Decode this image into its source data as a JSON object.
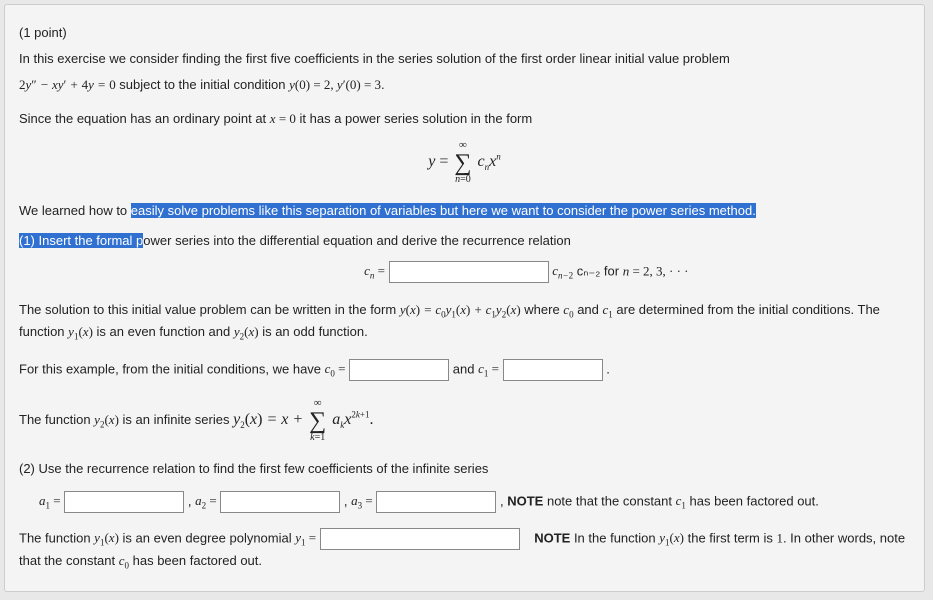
{
  "header": {
    "points": "(1 point)",
    "intro": "In this exercise we consider finding the first five coefficients in the series solution of the first order linear initial value problem",
    "eq_lhs": "2y″ − xy′ + 4y = 0",
    "subject": " subject to the initial condition ",
    "ic": "y(0) = 2, y′(0) = 3",
    "period": "."
  },
  "ordinary": {
    "t1": "Since the equation has an ordinary point at ",
    "eq": "x = 0",
    "t2": " it has a power series solution in the form"
  },
  "series": {
    "y_eq": "y = ",
    "sum_top": "∞",
    "sum_bot": "n=0",
    "term": "cₙxⁿ"
  },
  "q1": {
    "learned": "We learned how to ",
    "hl1": "easily solve problems like this separation of variables but here we want to consider the power series method.",
    "hl2": "(1) Insert the formal p",
    "rest": "ower series into the differential equation and derive the recurrence relation"
  },
  "recur": {
    "lhs": "cₙ =",
    "rhs1": " cₙ₋₂ for ",
    "rhs2": "n = 2, 3, · · ·"
  },
  "sol": {
    "t1": "The solution to this initial value problem can be written in the form ",
    "eq": "y(x) = c₀y₁(x) + c₁y₂(x)",
    "t2": " where ",
    "c0": "c₀",
    "and": " and ",
    "c1": "c₁",
    "t3": " are determined from the initial conditions. The function ",
    "y1": "y₁(x)",
    "t4": " is an even function and ",
    "y2": "y₂(x)",
    "t5": " is an odd function."
  },
  "init": {
    "t1": "For this example, from the initial conditions, we have ",
    "c0": "c₀ =",
    "and": " and ",
    "c1": "c₁ ="
  },
  "y2inf": {
    "t1": "The function ",
    "y2": "y₂(x)",
    "t2": " is an infinite series ",
    "lhs": "y₂(x) = x + ",
    "sum_top": "∞",
    "sum_bot": "k=1",
    "term_a": "aₖx",
    "term_exp": "2k+1",
    "dot": "."
  },
  "q2": {
    "t": "(2) Use the recurrence relation to find the first few coefficients of the infinite series"
  },
  "coeffs": {
    "a1": "a₁ =",
    "a2": "a₂ =",
    "a3": "a₃ =",
    "comma": ", ",
    "note_label": "NOTE",
    "note": " note that the constant ",
    "c1": "c₁",
    "note2": " has been factored out."
  },
  "y1poly": {
    "t1": "The function ",
    "y1": "y₁(x)",
    "t2": " is an even degree polynomial ",
    "lhs": "y₁ =",
    "note_label": "NOTE",
    "note1": " In the function ",
    "y1b": "y₁(x)",
    "note2": " the first term is ",
    "one": "1",
    "note3": ". In other words, note that the constant ",
    "c0": "c₀",
    "note4": " has been factored out."
  }
}
